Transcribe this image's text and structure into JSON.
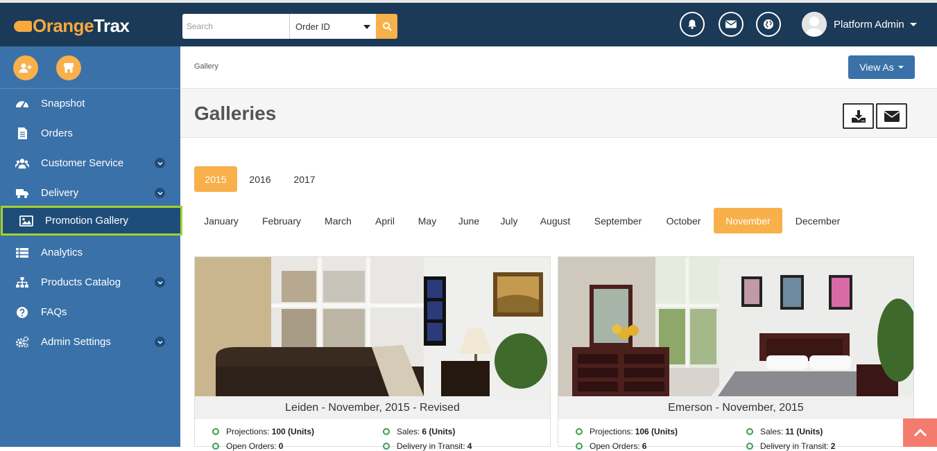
{
  "header": {
    "logo_orange": "Orange",
    "logo_white": "Trax",
    "search_placeholder": "Search",
    "search_select": "Order ID",
    "user_name": "Platform Admin"
  },
  "sidebar": {
    "items": [
      {
        "label": "Snapshot",
        "icon": "dashboard-icon"
      },
      {
        "label": "Orders",
        "icon": "document-icon"
      },
      {
        "label": "Customer Service",
        "icon": "users-icon"
      },
      {
        "label": "Delivery",
        "icon": "truck-icon"
      },
      {
        "label": "Promotion Gallery",
        "icon": "image-icon"
      },
      {
        "label": "Analytics",
        "icon": "list-icon"
      },
      {
        "label": "Products Catalog",
        "icon": "sitemap-icon"
      },
      {
        "label": "FAQs",
        "icon": "question-icon"
      },
      {
        "label": "Admin Settings",
        "icon": "gears-icon"
      }
    ],
    "active_item": "Promotion Gallery"
  },
  "breadcrumb": "Gallery",
  "view_as": "View As",
  "page_title": "Galleries",
  "years": [
    "2015",
    "2016",
    "2017"
  ],
  "selected_year": "2015",
  "months": [
    "January",
    "February",
    "March",
    "April",
    "May",
    "June",
    "July",
    "August",
    "September",
    "October",
    "November",
    "December"
  ],
  "selected_month": "November",
  "cards": [
    {
      "title": "Leiden - November, 2015 - Revised",
      "projections_label": "Projections:",
      "projections": "100 (Units)",
      "sales_label": "Sales:",
      "sales": "6 (Units)",
      "open_orders_label": "Open Orders:",
      "open_orders": "0",
      "in_transit_label": "Delivery in Transit:",
      "in_transit": "4"
    },
    {
      "title": "Emerson - November, 2015",
      "projections_label": "Projections:",
      "projections": "106 (Units)",
      "sales_label": "Sales:",
      "sales": "11 (Units)",
      "open_orders_label": "Open Orders:",
      "open_orders": "6",
      "in_transit_label": "Delivery in Transit:",
      "in_transit": "2"
    }
  ],
  "colors": {
    "topbar": "#1b3a57",
    "sidebar": "#3a71a8",
    "accent": "#f8b04a",
    "active_outline": "#a6d22a"
  }
}
